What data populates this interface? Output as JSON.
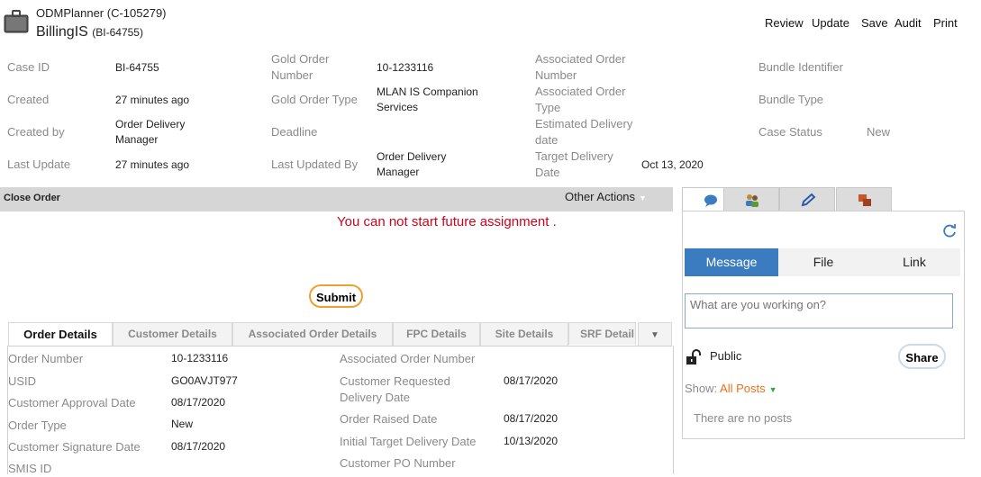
{
  "header": {
    "app_name": "ODMPlanner (C-105279)",
    "case_title": "BillingIS",
    "case_id_paren": "(BI-64755)",
    "actions": [
      "Review",
      "Update",
      "Save",
      "Audit",
      "Print"
    ]
  },
  "summary": {
    "case_id_label": "Case ID",
    "case_id": "BI-64755",
    "created_label": "Created",
    "created": "27 minutes ago",
    "created_by_label": "Created by",
    "created_by": "Order Delivery Manager",
    "last_update_label": "Last Update",
    "last_update": "27 minutes ago",
    "gold_order_number_label": "Gold Order Number",
    "gold_order_number": "10-1233116",
    "gold_order_type_label": "Gold Order Type",
    "gold_order_type": "MLAN IS Companion Services",
    "deadline_label": "Deadline",
    "last_updated_by_label": "Last Updated By",
    "last_updated_by": "Order Delivery Manager",
    "assoc_order_number_label": "Associated Order Number",
    "assoc_order_type_label": "Associated Order Type",
    "est_delivery_label": "Estimated Delivery date",
    "target_delivery_label": "Target Delivery Date",
    "target_delivery": "Oct 13, 2020",
    "bundle_identifier_label": "Bundle Identifier",
    "bundle_type_label": "Bundle Type",
    "case_status_label": "Case Status",
    "case_status": "New"
  },
  "action_bar": {
    "title": "Close Order",
    "other_actions": "Other Actions"
  },
  "error_message": "You can not start future assignment .",
  "submit_label": "Submit",
  "tabs": [
    "Order Details",
    "Customer Details",
    "Associated Order Details",
    "FPC Details",
    "Site Details",
    "SRF Detail"
  ],
  "order_details": {
    "left": [
      {
        "label": "Order Number",
        "value": "10-1233116"
      },
      {
        "label": "USID",
        "value": "GO0AVJT977"
      },
      {
        "label": "Customer Approval Date",
        "value": "08/17/2020"
      },
      {
        "label": "Order Type",
        "value": "New"
      },
      {
        "label": "Customer Signature Date",
        "value": "08/17/2020"
      },
      {
        "label": "SMIS ID",
        "value": ""
      }
    ],
    "right": [
      {
        "label": "Associated Order Number",
        "value": ""
      },
      {
        "label": "Customer Requested Delivery Date",
        "value": "08/17/2020"
      },
      {
        "label": "Order Raised Date",
        "value": "08/17/2020"
      },
      {
        "label": "Initial Target Delivery Date",
        "value": "10/13/2020"
      },
      {
        "label": "Customer PO Number",
        "value": ""
      }
    ]
  },
  "social": {
    "tab_icons": [
      "speech-bubble-icon",
      "people-icon",
      "pencil-icon",
      "stack-icon"
    ],
    "segments": [
      "Message",
      "File",
      "Link"
    ],
    "input_placeholder": "What are you working on?",
    "visibility": "Public",
    "share_label": "Share",
    "show_label": "Show:",
    "show_filter": "All Posts",
    "empty_text": "There are no posts"
  },
  "colors": {
    "accent": "#3b7bbf",
    "error": "#d0021b",
    "submit_border": "#f0a030",
    "filter": "#e8731a"
  }
}
